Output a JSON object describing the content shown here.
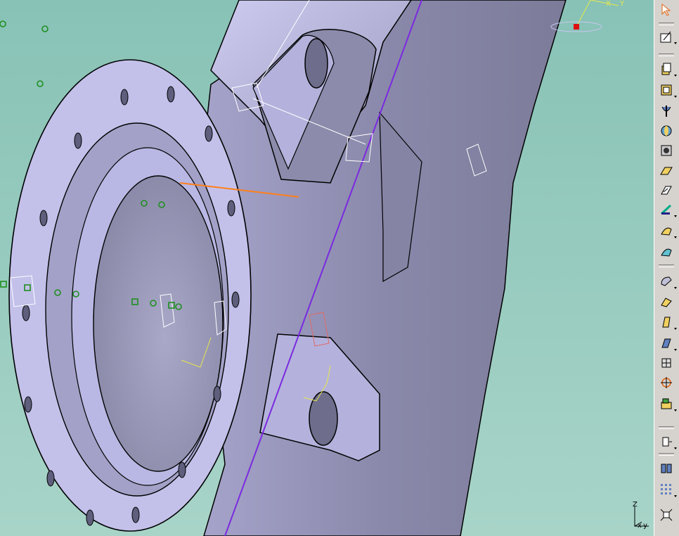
{
  "viewport": {
    "background_top": "#88c2b6",
    "background_bottom": "#a8d4c8",
    "part_color": "#b7b5e0",
    "part_shadow": "#7e7d9b",
    "edge_color": "#000000",
    "highlight_line": "#7b2ae0",
    "sketch_orange": "#ff7f1a",
    "sketch_yellow": "#e7e74a",
    "point_green": "#1f8f1f"
  },
  "compass": {
    "labels": [
      "X",
      "Y"
    ]
  },
  "axis_triad": {
    "z": "Z",
    "x": "x",
    "y": "y"
  },
  "toolbar": {
    "buttons": [
      {
        "icon": "select-arrow-icon",
        "dropdown": false
      },
      {
        "icon": "sketcher-icon",
        "dropdown": true
      },
      {
        "icon": "pad-icon",
        "dropdown": true
      },
      {
        "icon": "pocket-icon",
        "dropdown": true
      },
      {
        "icon": "shaft-icon",
        "dropdown": false
      },
      {
        "icon": "groove-icon",
        "dropdown": false
      },
      {
        "icon": "hole-icon",
        "dropdown": false
      },
      {
        "icon": "rib-icon",
        "dropdown": false
      },
      {
        "icon": "slot-icon",
        "dropdown": false
      },
      {
        "icon": "stiffener-icon",
        "dropdown": true
      },
      {
        "icon": "multi-section-solid-icon",
        "dropdown": true
      },
      {
        "icon": "removed-multi-section-icon",
        "dropdown": false
      },
      {
        "icon": "edge-fillet-icon",
        "dropdown": true
      },
      {
        "icon": "chamfer-icon",
        "dropdown": false
      },
      {
        "icon": "draft-angle-icon",
        "dropdown": true
      },
      {
        "icon": "shell-icon",
        "dropdown": true
      },
      {
        "icon": "thickness-icon",
        "dropdown": false
      },
      {
        "icon": "thread-icon",
        "dropdown": false
      },
      {
        "icon": "remove-face-icon",
        "dropdown": true
      },
      {
        "icon": "translation-icon",
        "dropdown": true
      },
      {
        "icon": "mirror-icon",
        "dropdown": false
      },
      {
        "icon": "rectangular-pattern-icon",
        "dropdown": true
      },
      {
        "icon": "scaling-icon",
        "dropdown": false
      }
    ]
  }
}
